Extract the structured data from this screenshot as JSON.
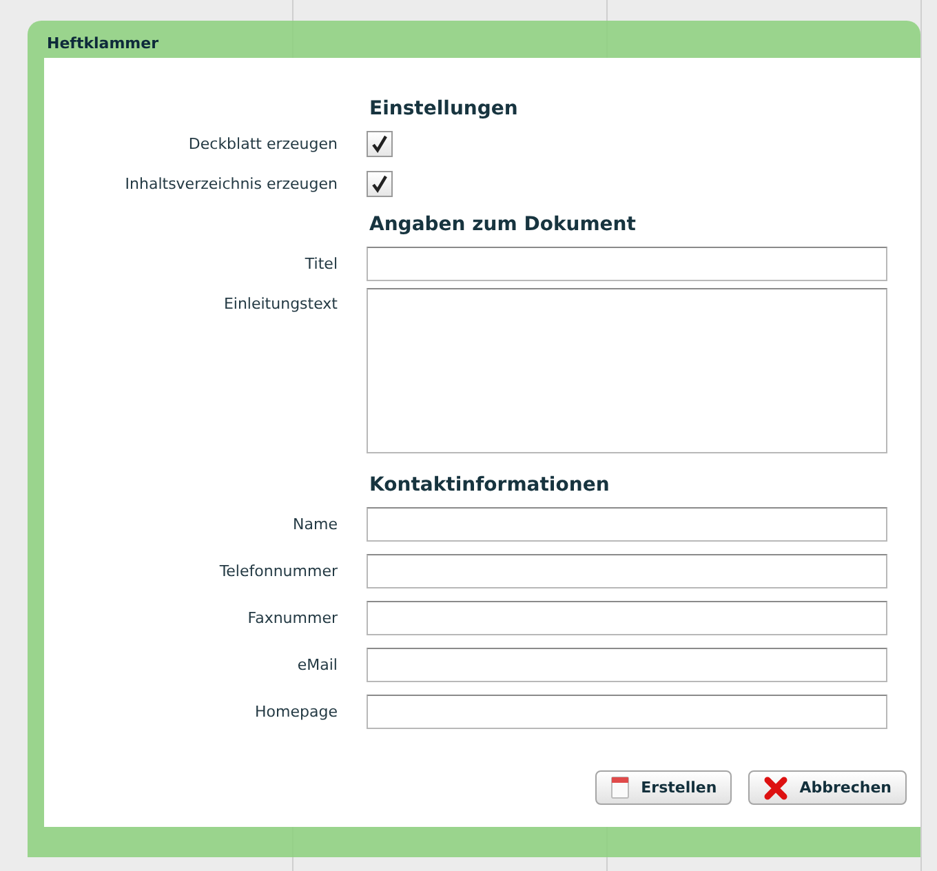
{
  "window": {
    "title": "Heftklammer"
  },
  "sections": [
    {
      "heading": "Einstellungen",
      "fields": [
        {
          "kind": "checkbox",
          "label": "Deckblatt erzeugen",
          "checked": true
        },
        {
          "kind": "checkbox",
          "label": "Inhaltsverzeichnis erzeugen",
          "checked": true
        }
      ]
    },
    {
      "heading": "Angaben zum Dokument",
      "fields": [
        {
          "kind": "text",
          "label": "Titel"
        },
        {
          "kind": "textarea",
          "label": "Einleitungstext"
        }
      ]
    },
    {
      "heading": "Kontaktinformationen",
      "fields": [
        {
          "kind": "text",
          "label": "Name"
        },
        {
          "kind": "text",
          "label": "Telefonnummer"
        },
        {
          "kind": "text",
          "label": "Faxnummer"
        },
        {
          "kind": "text",
          "label": "eMail"
        },
        {
          "kind": "text",
          "label": "Homepage"
        }
      ]
    }
  ],
  "buttons": [
    {
      "kind": "create",
      "label": "Erstellen"
    },
    {
      "kind": "cancel",
      "label": "Abbrechen"
    }
  ]
}
